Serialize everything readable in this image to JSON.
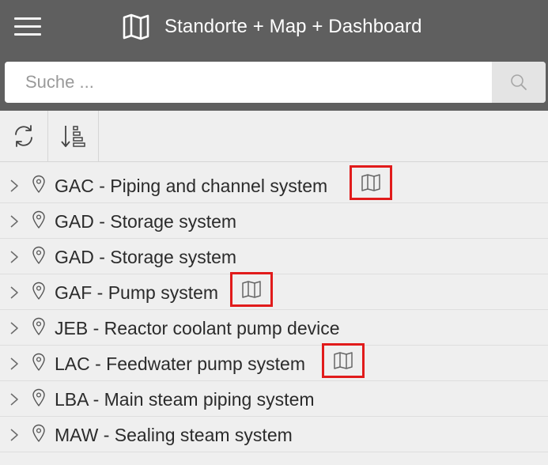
{
  "header": {
    "title": "Standorte + Map + Dashboard",
    "menu_icon": "hamburger-menu-icon",
    "title_icon": "map-icon"
  },
  "search": {
    "placeholder": "Suche ...",
    "value": "",
    "button_icon": "search-icon"
  },
  "toolbar": {
    "buttons": [
      {
        "name": "refresh",
        "icon": "refresh-icon"
      },
      {
        "name": "sort",
        "icon": "sort-descending-icon"
      }
    ]
  },
  "list": {
    "items": [
      {
        "label": "GAC - Piping and channel system",
        "has_map": true
      },
      {
        "label": "GAD - Storage system",
        "has_map": false
      },
      {
        "label": "GAD - Storage system",
        "has_map": false
      },
      {
        "label": "GAF - Pump system",
        "has_map": true
      },
      {
        "label": "JEB - Reactor coolant pump device",
        "has_map": false
      },
      {
        "label": "LAC - Feedwater pump system",
        "has_map": true
      },
      {
        "label": "LBA - Main steam piping system",
        "has_map": false
      },
      {
        "label": "MAW - Sealing steam system",
        "has_map": false
      }
    ]
  },
  "colors": {
    "header_bg": "#5f5f5f",
    "page_bg": "#efefef",
    "highlight_border": "#e11b1b"
  }
}
